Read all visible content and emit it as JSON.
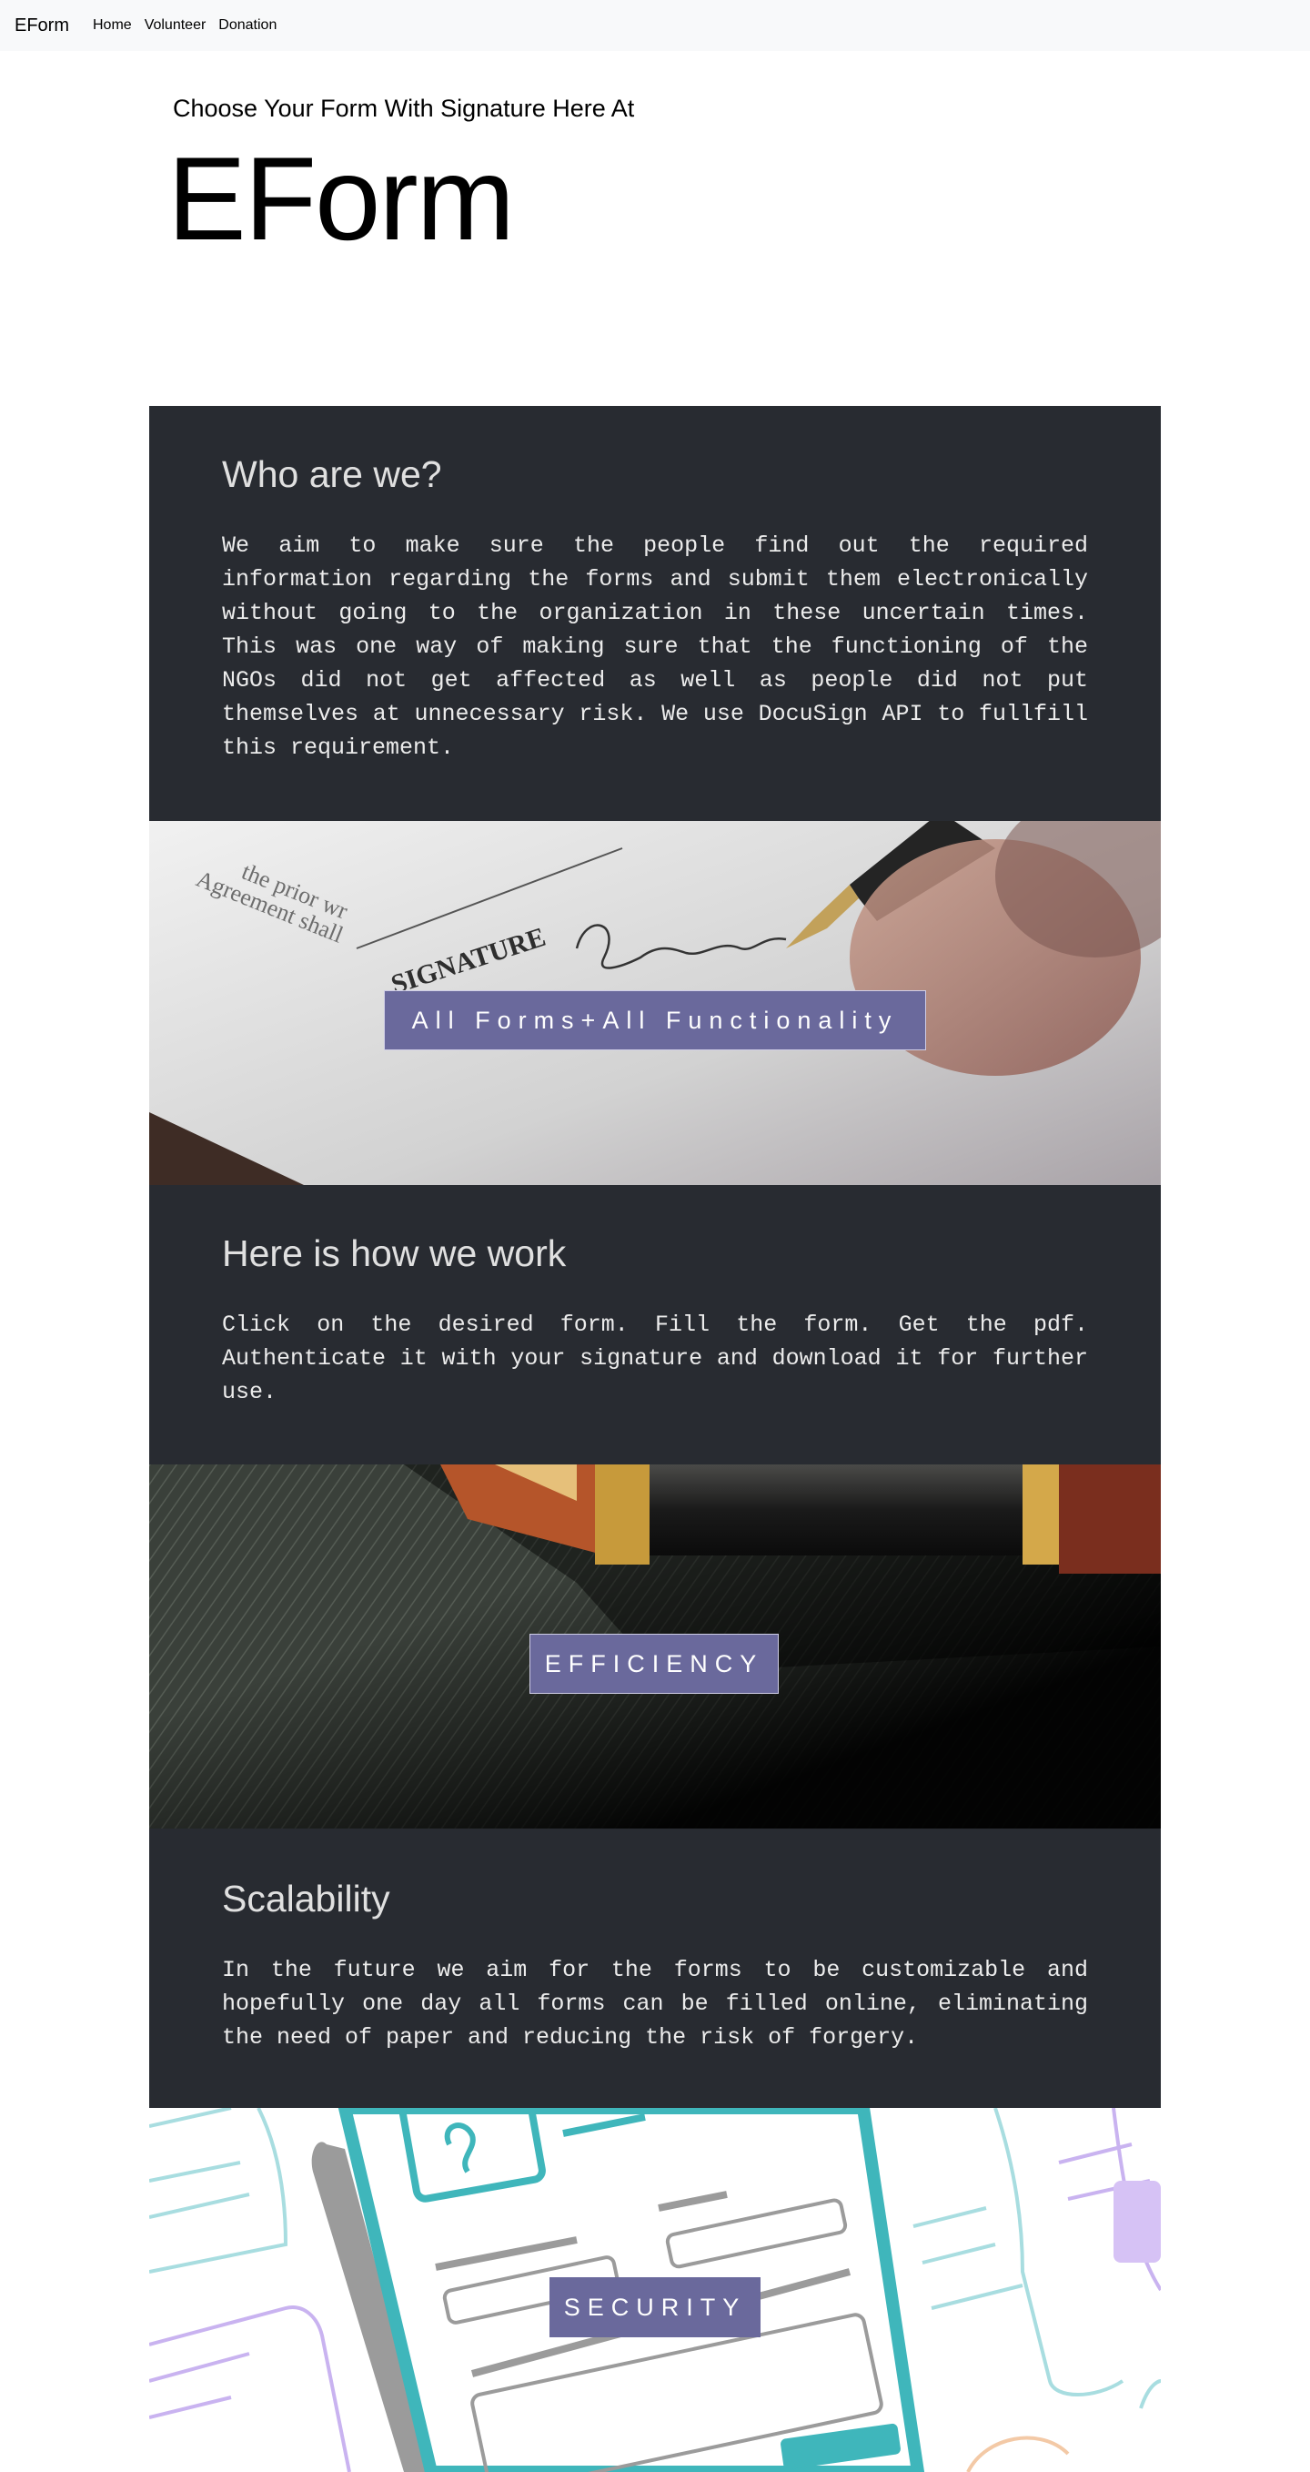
{
  "navbar": {
    "brand": "EForm",
    "links": [
      "Home",
      "Volunteer",
      "Donation"
    ]
  },
  "hero": {
    "subtitle": "Choose Your Form With Signature Here At",
    "title": "EForm"
  },
  "sections": {
    "who": {
      "heading": "Who are we?",
      "body": "We aim to make sure the people find out the required information regarding the forms and submit them electronically without going to the organization in these uncertain times. This was one way of making sure that the functioning of the NGOs did not get affected as well as people did not put themselves at unnecessary risk. We use DocuSign API to fullfill this requirement."
    },
    "banner1": {
      "caption": "All Forms+All Functionality"
    },
    "how": {
      "heading": "Here is how we work",
      "body": "Click on the desired form. Fill the form. Get the pdf. Authenticate it with your signature and download it for further use."
    },
    "banner2": {
      "caption": "EFFICIENCY"
    },
    "scale": {
      "heading": "Scalability",
      "body": "In the future we aim for the forms to be customizable and hopefully one day all forms can be filled online, eliminating the need of paper and reducing the risk of forgery."
    },
    "banner3": {
      "caption": "SECURITY"
    }
  },
  "colors": {
    "navbar_bg": "#f8f9fa",
    "section_bg": "#282b31",
    "caption_bg": "#6a699c",
    "teal": "#3fb6bb",
    "lavender": "#c9b3f0"
  },
  "icons": {
    "banner1_image": "document-signature-photo",
    "banner2_image": "fountain-pen-photo",
    "banner3_image": "phone-form-illustration"
  }
}
